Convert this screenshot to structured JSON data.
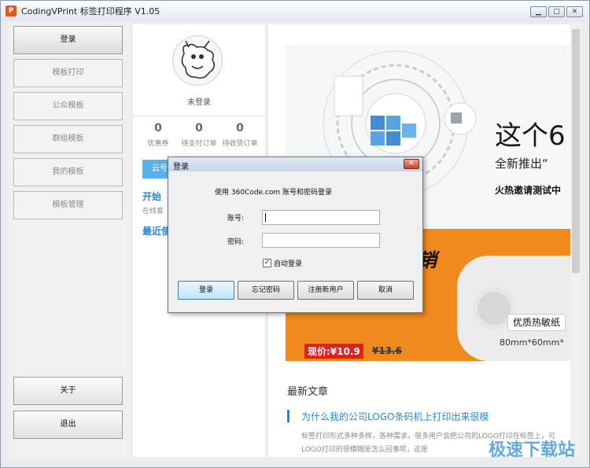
{
  "window": {
    "title": "CodingVPrint 标签打印程序 V1.05",
    "app_icon": "P",
    "controls": {
      "minimize": "▁",
      "maximize": "□",
      "close": "✕"
    }
  },
  "sidebar": {
    "items": [
      {
        "label": "登录"
      },
      {
        "label": "模板打印"
      },
      {
        "label": "公众模板"
      },
      {
        "label": "群组模板"
      },
      {
        "label": "我的模板"
      },
      {
        "label": "模板管理"
      }
    ],
    "about": "关于",
    "exit": "退出"
  },
  "profile": {
    "status": "未登录",
    "stats": [
      {
        "value": "0",
        "label": "优惠券"
      },
      {
        "value": "0",
        "label": "待支付订单"
      },
      {
        "value": "0",
        "label": "待收货订单"
      }
    ],
    "cloud_button": "云号",
    "start_title": "开始",
    "start_sub": "在线客",
    "recent_title": "最近使"
  },
  "banner": {
    "headline": "这个6",
    "subline": "全新推出“",
    "invite": "火热邀请测试中"
  },
  "promo": {
    "slogan": "促销",
    "tag": "优质热敏纸",
    "size": "80mm*60mm*",
    "price": "现价:¥10.9",
    "old_price": "¥13.6"
  },
  "articles": {
    "heading": "最新文章",
    "title": "为什么我的公司LOGO条码机上打印出来很模",
    "excerpt": "标签打印形式多种多样，各种需求，很多用户会把公司的LOGO打印在标签上，可LOGO打印的很模糊是怎么回事呢，这是"
  },
  "watermark": "极速下载站",
  "dialog": {
    "title": "登录",
    "close": "✕",
    "intro": "使用 360Code.com 账号和密码登录",
    "account_label": "账号:",
    "account_value": "",
    "password_label": "密码:",
    "password_value": "",
    "auto_login": "自动登录",
    "auto_login_checked": "✓",
    "buttons": {
      "login": "登录",
      "forgot": "忘记密码",
      "register": "注册新用户",
      "cancel": "取消"
    }
  }
}
